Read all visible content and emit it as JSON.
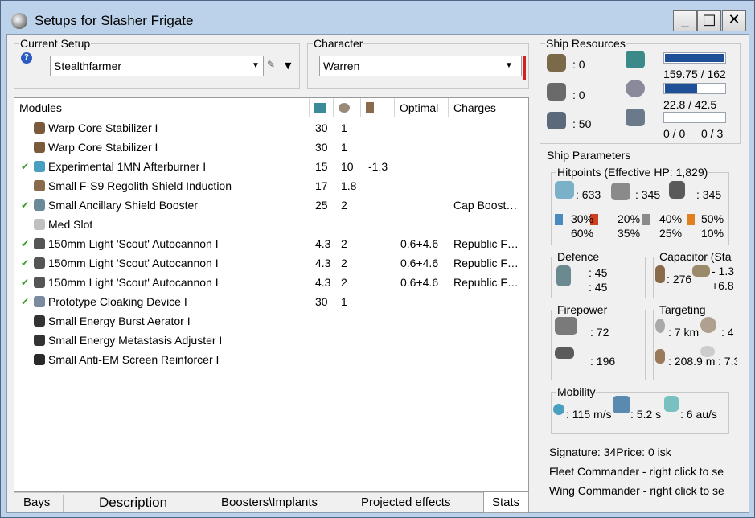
{
  "window": {
    "title": "Setups for Slasher Frigate",
    "minimize": "_",
    "maximize": "□",
    "close": "✕"
  },
  "setup": {
    "legend": "Current Setup",
    "value": "Stealthfarmer",
    "help": "?"
  },
  "character": {
    "legend": "Character",
    "value": "Warren"
  },
  "modules": {
    "headers": {
      "name": "Modules",
      "optimal": "Optimal",
      "charges": "Charges"
    },
    "rows": [
      {
        "checked": false,
        "name": "Warp Core Stabilizer I",
        "cpu": "30",
        "pg": "1",
        "cap": "",
        "optimal": "",
        "charges": "",
        "icon": "stabilizer-icon",
        "color": "#7a5a3a"
      },
      {
        "checked": false,
        "name": "Warp Core Stabilizer I",
        "cpu": "30",
        "pg": "1",
        "cap": "",
        "optimal": "",
        "charges": "",
        "icon": "stabilizer-icon",
        "color": "#7a5a3a"
      },
      {
        "checked": true,
        "name": "Experimental 1MN Afterburner I",
        "cpu": "15",
        "pg": "10",
        "cap": "-1.3",
        "optimal": "",
        "charges": "",
        "icon": "afterburner-icon",
        "color": "#4aa0c0"
      },
      {
        "checked": false,
        "name": "Small F-S9 Regolith Shield Induction",
        "cpu": "17",
        "pg": "1.8",
        "cap": "",
        "optimal": "",
        "charges": "",
        "icon": "shield-induction-icon",
        "color": "#8a6a4a"
      },
      {
        "checked": true,
        "name": "Small Ancillary Shield Booster",
        "cpu": "25",
        "pg": "2",
        "cap": "",
        "optimal": "",
        "charges": "Cap Boost…",
        "icon": "shield-booster-icon",
        "color": "#6a8a9a"
      },
      {
        "checked": false,
        "name": "Med Slot",
        "cpu": "",
        "pg": "",
        "cap": "",
        "optimal": "",
        "charges": "",
        "icon": "empty-slot-icon",
        "color": "#c0c0c0"
      },
      {
        "checked": true,
        "name": "150mm Light 'Scout' Autocannon I",
        "cpu": "4.3",
        "pg": "2",
        "cap": "",
        "optimal": "0.6+4.6",
        "charges": "Republic F…",
        "icon": "autocannon-icon",
        "color": "#555"
      },
      {
        "checked": true,
        "name": "150mm Light 'Scout' Autocannon I",
        "cpu": "4.3",
        "pg": "2",
        "cap": "",
        "optimal": "0.6+4.6",
        "charges": "Republic F…",
        "icon": "autocannon-icon",
        "color": "#555"
      },
      {
        "checked": true,
        "name": "150mm Light 'Scout' Autocannon I",
        "cpu": "4.3",
        "pg": "2",
        "cap": "",
        "optimal": "0.6+4.6",
        "charges": "Republic F…",
        "icon": "autocannon-icon",
        "color": "#555"
      },
      {
        "checked": true,
        "name": "Prototype Cloaking Device I",
        "cpu": "30",
        "pg": "1",
        "cap": "",
        "optimal": "",
        "charges": "",
        "icon": "cloak-icon",
        "color": "#7a8aa0"
      },
      {
        "checked": false,
        "name": "Small Energy Burst Aerator I",
        "cpu": "",
        "pg": "",
        "cap": "",
        "optimal": "",
        "charges": "",
        "icon": "rig-icon",
        "color": "#333"
      },
      {
        "checked": false,
        "name": "Small Energy Metastasis Adjuster I",
        "cpu": "",
        "pg": "",
        "cap": "",
        "optimal": "",
        "charges": "",
        "icon": "rig-icon",
        "color": "#333"
      },
      {
        "checked": false,
        "name": "Small Anti-EM Screen Reinforcer I",
        "cpu": "",
        "pg": "",
        "cap": "",
        "optimal": "",
        "charges": "",
        "icon": "rig-icon",
        "color": "#2a2a2a"
      }
    ],
    "check_glyph": "✔"
  },
  "tabs": [
    "Bays",
    "Description",
    "Boosters\\Implants",
    "Projected effects",
    "Stats"
  ],
  "resources": {
    "legend": "Ship Resources",
    "turret": ": 0",
    "launcher": ": 0",
    "drone": ": 50",
    "cpu": "159.75 / 162",
    "pg": "22.8 / 42.5",
    "calib": "0 / 0",
    "calib2": "0 / 3",
    "cpu_fill": 0.98,
    "pg_fill": 0.54
  },
  "params": {
    "legend": "Ship Parameters"
  },
  "hitpoints": {
    "legend": "Hitpoints (Effective HP: 1,829)",
    "shield": ": 633",
    "armor": ": 345",
    "hull": ": 345",
    "res": [
      [
        "30%",
        "20%",
        "40%",
        "50%"
      ],
      [
        "60%",
        "35%",
        "25%",
        "10%"
      ]
    ]
  },
  "defence": {
    "legend": "Defence",
    "a": ": 45",
    "b": ": 45"
  },
  "capacitor": {
    "legend": "Capacitor (Sta",
    "cap": ": 276",
    "d1": "- 1.3",
    "d2": "+6.8"
  },
  "firepower": {
    "legend": "Firepower",
    "a": ": 72",
    "b": ": 196"
  },
  "targeting": {
    "legend": "Targeting",
    "range": ": 7 km",
    "targets": ": 4",
    "res": ": 208.9 m",
    "scan": ": 7.3"
  },
  "mobility": {
    "legend": "Mobility",
    "speed": ": 115 m/s",
    "align": ": 5.2 s",
    "warp": ": 6 au/s"
  },
  "info": {
    "line1": "Signature: 34Price: 0 isk",
    "line2": "Fleet Commander - right click to se",
    "line3": "Wing Commander - right click to se"
  }
}
